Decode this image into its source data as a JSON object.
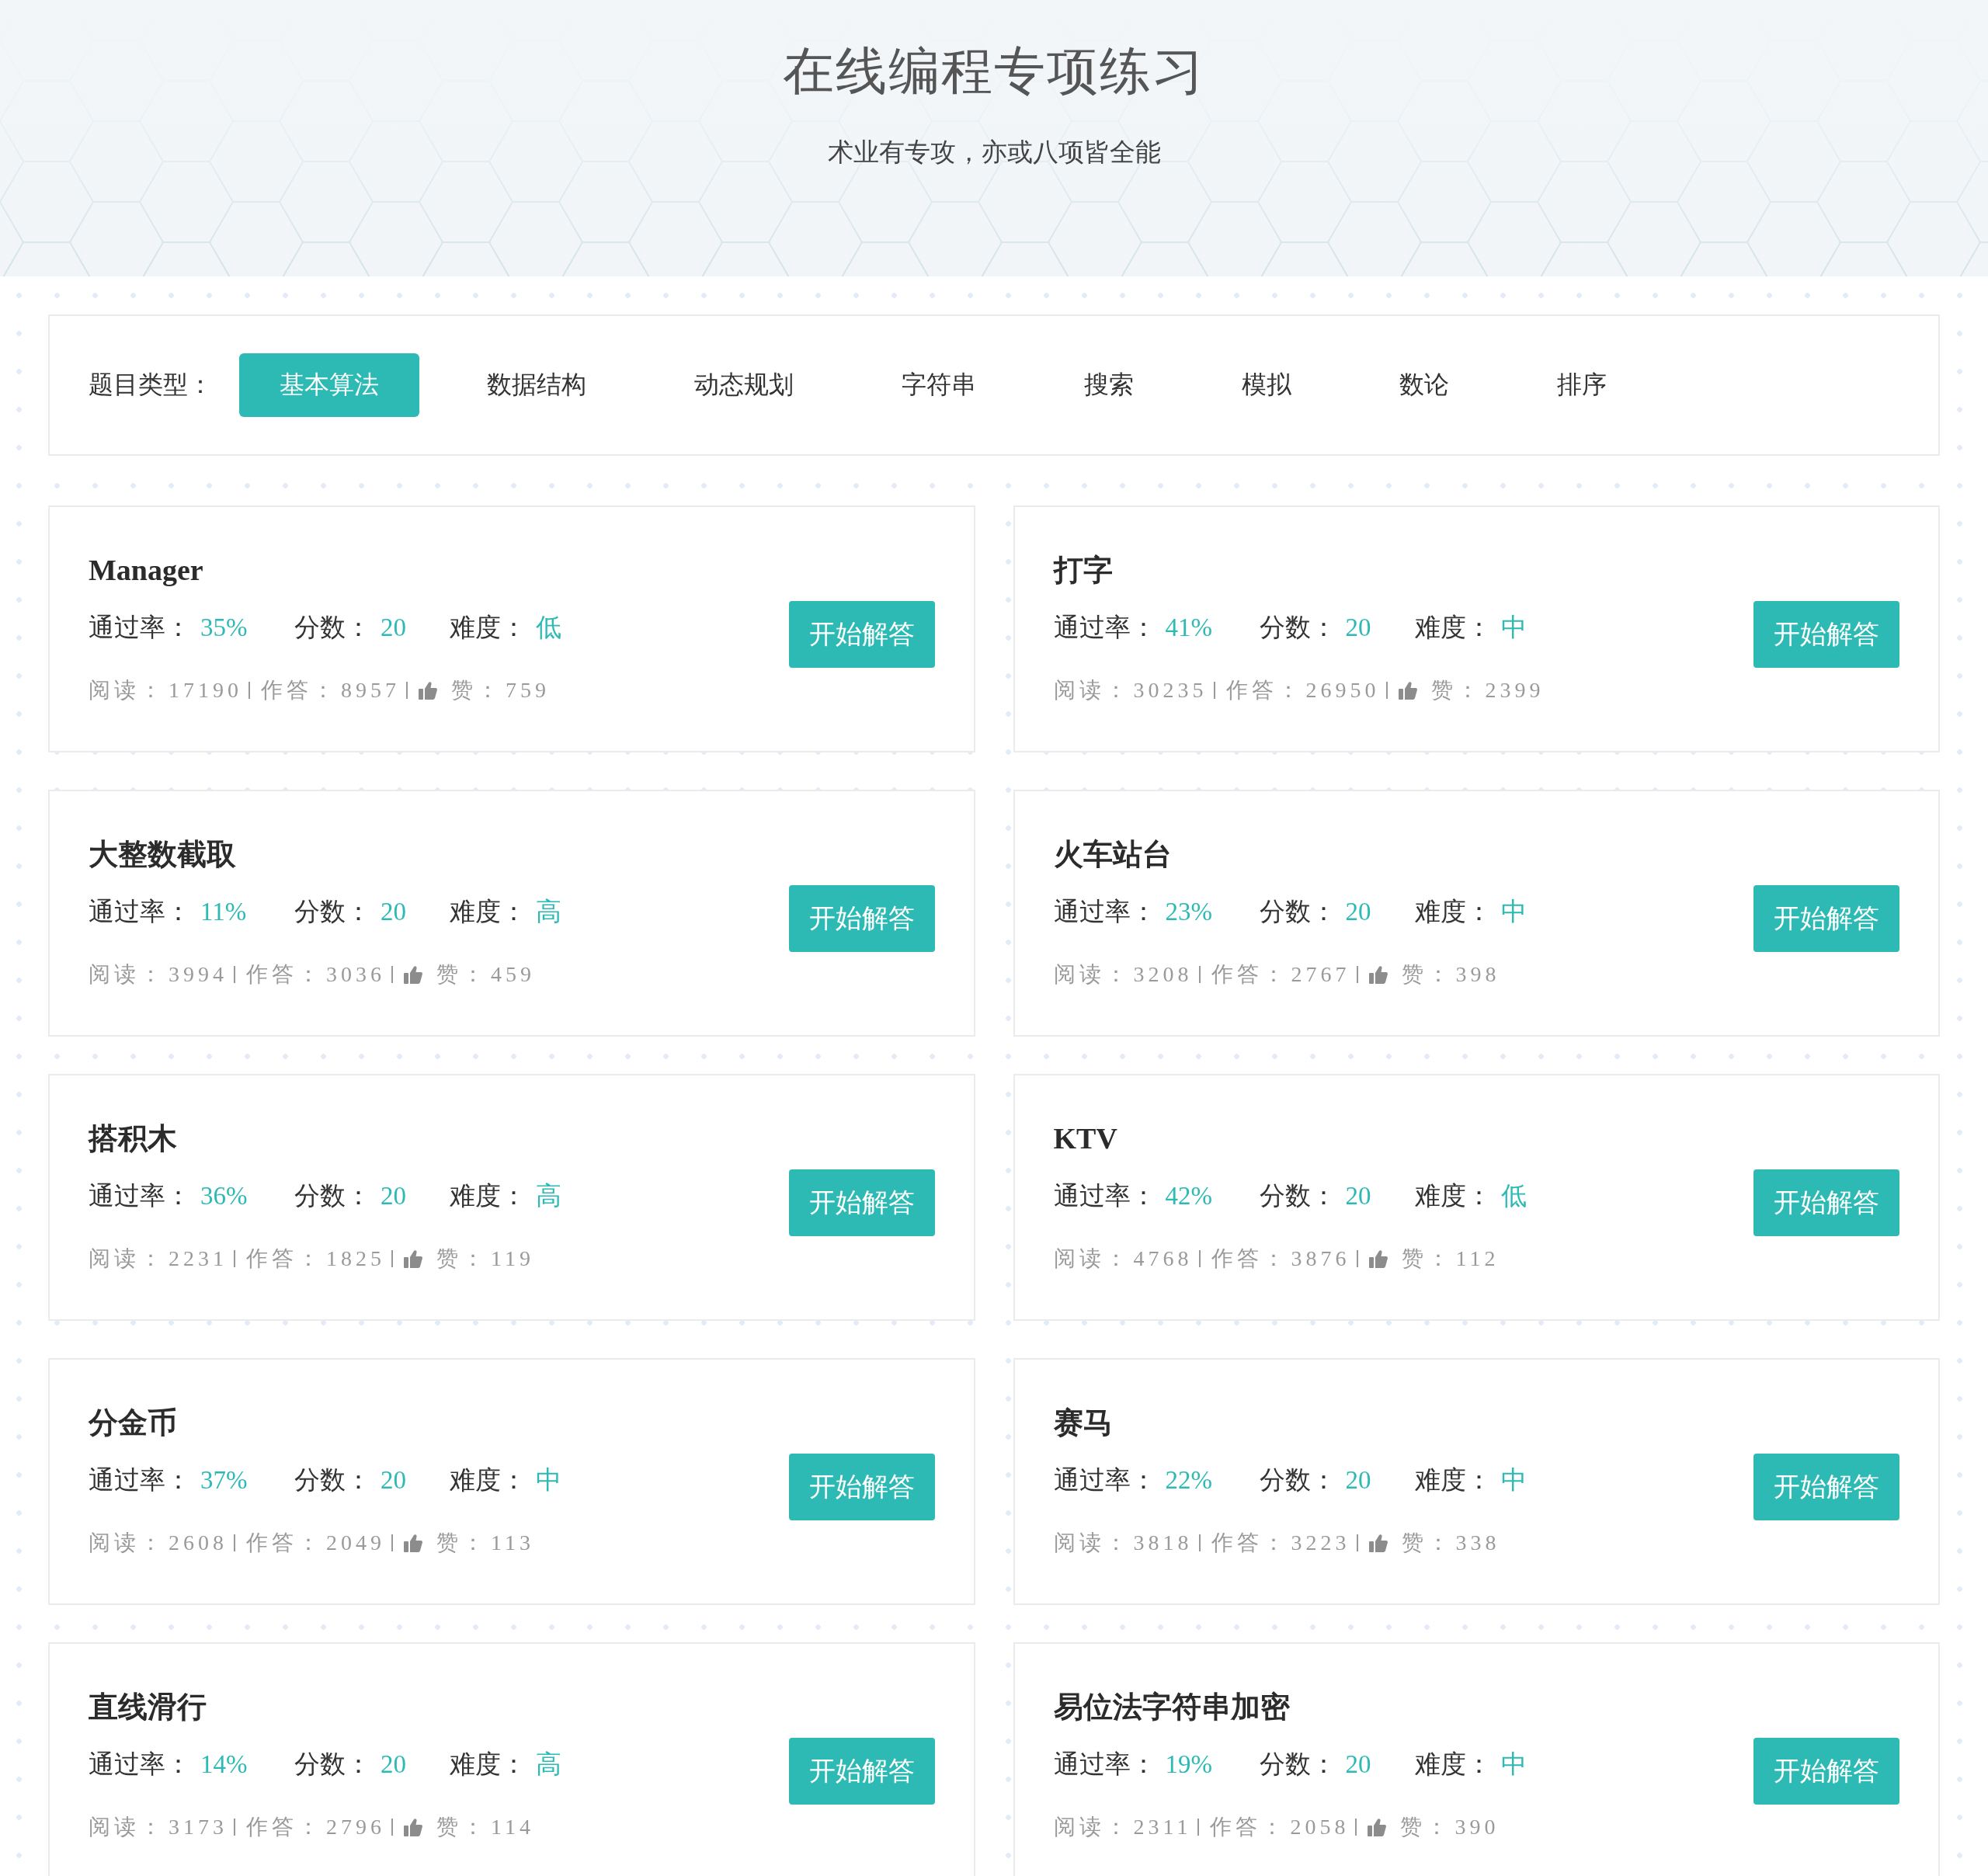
{
  "header": {
    "title": "在线编程专项练习",
    "subtitle": "术业有专攻，亦或八项皆全能"
  },
  "filter": {
    "label": "题目类型：",
    "tabs": [
      {
        "label": "基本算法",
        "selected": true
      },
      {
        "label": "数据结构",
        "selected": false
      },
      {
        "label": "动态规划",
        "selected": false
      },
      {
        "label": "字符串",
        "selected": false
      },
      {
        "label": "搜索",
        "selected": false
      },
      {
        "label": "模拟",
        "selected": false
      },
      {
        "label": "数论",
        "selected": false
      },
      {
        "label": "排序",
        "selected": false
      }
    ]
  },
  "problems": [
    {
      "title": "Manager",
      "stats": [
        {
          "label": "通过率：",
          "value": "35%"
        },
        {
          "label": "分数：",
          "value": "20"
        },
        {
          "label": "难度：",
          "value": "低"
        }
      ],
      "meta": {
        "reads": {
          "label": "阅读：",
          "value": "17190"
        },
        "answers": {
          "label": "作答：",
          "value": "8957"
        },
        "likes": {
          "label": "赞：",
          "value": "759"
        }
      },
      "button": "开始解答"
    },
    {
      "title": "打字",
      "stats": [
        {
          "label": "通过率：",
          "value": "41%"
        },
        {
          "label": "分数：",
          "value": "20"
        },
        {
          "label": "难度：",
          "value": "中"
        }
      ],
      "meta": {
        "reads": {
          "label": "阅读：",
          "value": "30235"
        },
        "answers": {
          "label": "作答：",
          "value": "26950"
        },
        "likes": {
          "label": "赞：",
          "value": "2399"
        }
      },
      "button": "开始解答"
    },
    {
      "title": "大整数截取",
      "stats": [
        {
          "label": "通过率：",
          "value": "11%"
        },
        {
          "label": "分数：",
          "value": "20"
        },
        {
          "label": "难度：",
          "value": "高"
        }
      ],
      "meta": {
        "reads": {
          "label": "阅读：",
          "value": "3994"
        },
        "answers": {
          "label": "作答：",
          "value": "3036"
        },
        "likes": {
          "label": "赞：",
          "value": "459"
        }
      },
      "button": "开始解答"
    },
    {
      "title": "火车站台",
      "stats": [
        {
          "label": "通过率：",
          "value": "23%"
        },
        {
          "label": "分数：",
          "value": "20"
        },
        {
          "label": "难度：",
          "value": "中"
        }
      ],
      "meta": {
        "reads": {
          "label": "阅读：",
          "value": "3208"
        },
        "answers": {
          "label": "作答：",
          "value": "2767"
        },
        "likes": {
          "label": "赞：",
          "value": "398"
        }
      },
      "button": "开始解答"
    },
    {
      "title": "搭积木",
      "stats": [
        {
          "label": "通过率：",
          "value": "36%"
        },
        {
          "label": "分数：",
          "value": "20"
        },
        {
          "label": "难度：",
          "value": "高"
        }
      ],
      "meta": {
        "reads": {
          "label": "阅读：",
          "value": "2231"
        },
        "answers": {
          "label": "作答：",
          "value": "1825"
        },
        "likes": {
          "label": "赞：",
          "value": "119"
        }
      },
      "button": "开始解答"
    },
    {
      "title": "KTV",
      "stats": [
        {
          "label": "通过率：",
          "value": "42%"
        },
        {
          "label": "分数：",
          "value": "20"
        },
        {
          "label": "难度：",
          "value": "低"
        }
      ],
      "meta": {
        "reads": {
          "label": "阅读：",
          "value": "4768"
        },
        "answers": {
          "label": "作答：",
          "value": "3876"
        },
        "likes": {
          "label": "赞：",
          "value": "112"
        }
      },
      "button": "开始解答"
    },
    {
      "title": "分金币",
      "stats": [
        {
          "label": "通过率：",
          "value": "37%"
        },
        {
          "label": "分数：",
          "value": "20"
        },
        {
          "label": "难度：",
          "value": "中"
        }
      ],
      "meta": {
        "reads": {
          "label": "阅读：",
          "value": "2608"
        },
        "answers": {
          "label": "作答：",
          "value": "2049"
        },
        "likes": {
          "label": "赞：",
          "value": "113"
        }
      },
      "button": "开始解答"
    },
    {
      "title": "赛马",
      "stats": [
        {
          "label": "通过率：",
          "value": "22%"
        },
        {
          "label": "分数：",
          "value": "20"
        },
        {
          "label": "难度：",
          "value": "中"
        }
      ],
      "meta": {
        "reads": {
          "label": "阅读：",
          "value": "3818"
        },
        "answers": {
          "label": "作答：",
          "value": "3223"
        },
        "likes": {
          "label": "赞：",
          "value": "338"
        }
      },
      "button": "开始解答"
    },
    {
      "title": "直线滑行",
      "stats": [
        {
          "label": "通过率：",
          "value": "14%"
        },
        {
          "label": "分数：",
          "value": "20"
        },
        {
          "label": "难度：",
          "value": "高"
        }
      ],
      "meta": {
        "reads": {
          "label": "阅读：",
          "value": "3173"
        },
        "answers": {
          "label": "作答：",
          "value": "2796"
        },
        "likes": {
          "label": "赞：",
          "value": "114"
        }
      },
      "button": "开始解答"
    },
    {
      "title": "易位法字符串加密",
      "stats": [
        {
          "label": "通过率：",
          "value": "19%"
        },
        {
          "label": "分数：",
          "value": "20"
        },
        {
          "label": "难度：",
          "value": "中"
        }
      ],
      "meta": {
        "reads": {
          "label": "阅读：",
          "value": "2311"
        },
        "answers": {
          "label": "作答：",
          "value": "2058"
        },
        "likes": {
          "label": "赞：",
          "value": "390"
        }
      },
      "button": "开始解答"
    }
  ]
}
